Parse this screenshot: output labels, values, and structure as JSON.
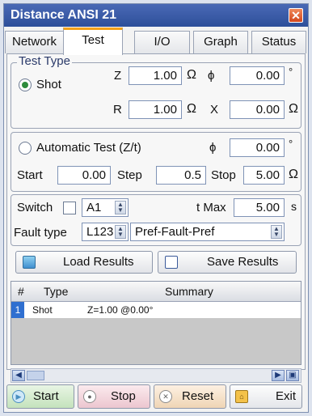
{
  "window": {
    "title": "Distance ANSI 21",
    "close_glyph": "✕"
  },
  "tabs": [
    {
      "label": "Network"
    },
    {
      "label": "Test",
      "active": true
    },
    {
      "label": "I/O"
    },
    {
      "label": "Graph"
    },
    {
      "label": "Status"
    }
  ],
  "test_type": {
    "group_label": "Test Type",
    "shot_label": "Shot",
    "shot_selected": true,
    "z_label": "Z",
    "z_value": "1.00",
    "z_unit": "Ω",
    "phi_label": "ϕ",
    "phi_value": "0.00",
    "phi_unit": "°",
    "r_label": "R",
    "r_value": "1.00",
    "r_unit": "Ω",
    "x_label": "X",
    "x_value": "0.00",
    "x_unit": "Ω"
  },
  "automatic": {
    "label": "Automatic Test (Z/t)",
    "selected": false,
    "phi_label": "ϕ",
    "phi_value": "0.00",
    "phi_unit": "°",
    "start_label": "Start",
    "start_value": "0.00",
    "step_label": "Step",
    "step_value": "0.5",
    "stop_label": "Stop",
    "stop_value": "5.00",
    "stop_unit": "Ω"
  },
  "switch": {
    "label": "Switch",
    "checked": false,
    "channel": "A1",
    "tmax_label": "t Max",
    "tmax_value": "5.00",
    "tmax_unit": "s"
  },
  "fault": {
    "label": "Fault type",
    "type": "L123",
    "sequence": "Pref-Fault-Pref"
  },
  "results": {
    "load_label": "Load Results",
    "save_label": "Save Results"
  },
  "table": {
    "columns": [
      "#",
      "Type",
      "Summary"
    ],
    "rows": [
      {
        "index": "1",
        "type": "Shot",
        "summary": "Z=1.00 @0.00°"
      }
    ]
  },
  "footer": {
    "start_label": "Start",
    "stop_label": "Stop",
    "reset_label": "Reset",
    "exit_label": "Exit"
  },
  "colors": {
    "title_bar": "#2d4f9a",
    "active_tab_accent": "#f2a11a",
    "row_index": "#2f6fd0",
    "stop_button": "#f7dde2",
    "reset_button": "#f7e6d2",
    "start_button": "#dcefd8"
  }
}
